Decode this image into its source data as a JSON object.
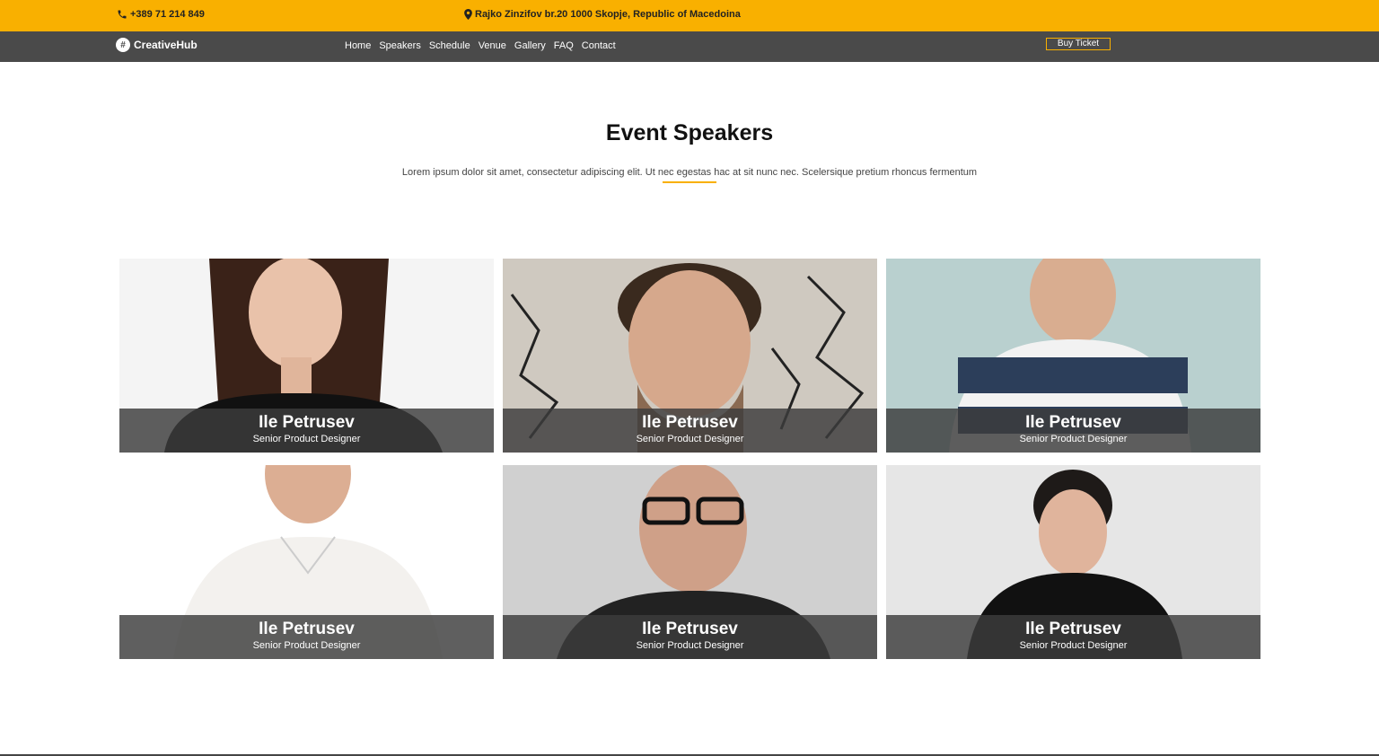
{
  "topbar": {
    "phone": "+389 71 214 849",
    "address": "Rajko Zinzifov br.20 1000 Skopje, Republic of Macedoina"
  },
  "nav": {
    "logo": "CreativeHub",
    "links": [
      "Home",
      "Speakers",
      "Schedule",
      "Venue",
      "Gallery",
      "FAQ",
      "Contact"
    ],
    "buy_ticket": "Buy Ticket"
  },
  "section": {
    "title": "Event Speakers",
    "subtitle": "Lorem ipsum dolor sit amet, consectetur adipiscing elit. Ut nec egestas hac at sit nunc nec. Scelersique pretium rhoncus fermentum"
  },
  "speakers": [
    {
      "name": "Ile Petrusev",
      "role": "Senior Product Designer"
    },
    {
      "name": "Ile Petrusev",
      "role": "Senior Product Designer"
    },
    {
      "name": "Ile Petrusev",
      "role": "Senior Product Designer"
    },
    {
      "name": "Ile Petrusev",
      "role": "Senior Product Designer"
    },
    {
      "name": "Ile Petrusev",
      "role": "Senior Product Designer"
    },
    {
      "name": "Ile Petrusev",
      "role": "Senior Product Designer"
    }
  ],
  "colors": {
    "accent": "#f9b000",
    "nav_bg": "#4a4a4a"
  }
}
